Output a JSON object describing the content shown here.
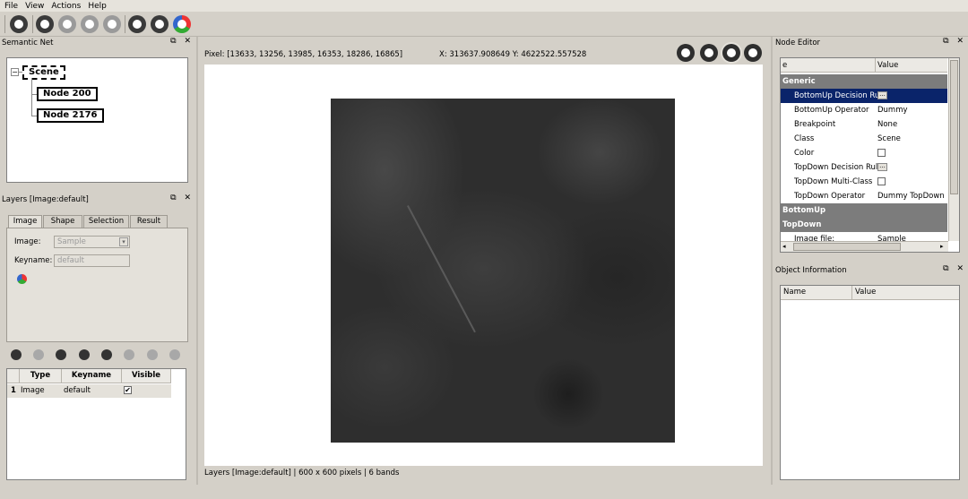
{
  "menu": [
    "File",
    "View",
    "Actions",
    "Help"
  ],
  "toolbar": {
    "icons": [
      "settings-icon",
      "back-icon",
      "back-disabled-icon",
      "forward-disabled-icon",
      "last-disabled-icon",
      "share-icon",
      "layers-icon",
      "color-icon"
    ]
  },
  "semantic_net": {
    "title": "Semantic Net",
    "nodes": [
      "Scene",
      "Node 200",
      "Node 2176"
    ],
    "expand_glyph": "−"
  },
  "layers_panel": {
    "title": "Layers [Image:default]",
    "tabs": [
      "Image",
      "Shape",
      "Selection",
      "Result"
    ],
    "image_label": "Image:",
    "image_value": "Sample",
    "keyname_label": "Keyname:",
    "keyname_value": "default",
    "table": {
      "headers": [
        "Type",
        "Keyname",
        "Visible"
      ],
      "rows": [
        {
          "index": "1",
          "type": "Image",
          "keyname": "default",
          "visible": "✔"
        }
      ]
    }
  },
  "center": {
    "pixel_readout": "Pixel: [13633, 13256, 13985, 16353, 18286, 16865]",
    "coord_readout": "X: 313637.908649  Y: 4622522.557528",
    "status": "Layers [Image:default] | 600 x 600 pixels | 6 bands"
  },
  "node_editor": {
    "title": "Node Editor",
    "col_name": "e",
    "col_value": "Value",
    "group_generic": "Generic",
    "props": [
      {
        "name": "BottomUp Decision Rule",
        "value": "..."
      },
      {
        "name": "BottomUp Operator",
        "value": "Dummy BottomUp"
      },
      {
        "name": "Breakpoint",
        "value": "None"
      },
      {
        "name": "Class",
        "value": "Scene"
      },
      {
        "name": "Color",
        "value": ""
      },
      {
        "name": "TopDown Decision Rule",
        "value": "..."
      },
      {
        "name": "TopDown Multi-Class",
        "value": ""
      },
      {
        "name": "TopDown Operator",
        "value": "Dummy TopDown"
      }
    ],
    "group_bottomup": "BottomUp",
    "group_topdown": "TopDown",
    "image_file_label": "Image file:",
    "image_file_value": "Sample"
  },
  "object_info": {
    "title": "Object Information",
    "col_name": "Name",
    "col_value": "Value"
  },
  "panel_controls": "⧉ ✕",
  "colors": {
    "selection": "#0a246a",
    "group_row": "#7c7c7c",
    "chrome": "#d4d0c8"
  }
}
